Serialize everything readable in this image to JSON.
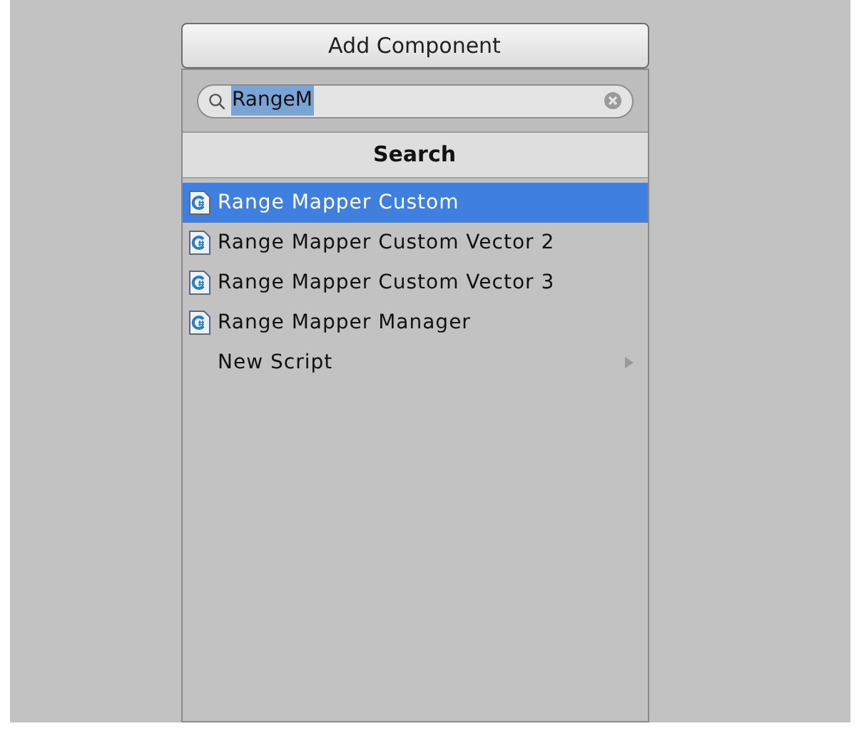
{
  "button": {
    "label": "Add Component"
  },
  "search": {
    "value": "RangeM",
    "text_selected": true
  },
  "header": {
    "title": "Search"
  },
  "items": [
    {
      "kind": "script",
      "label": "Range Mapper Custom",
      "selected": true
    },
    {
      "kind": "script",
      "label": "Range Mapper Custom Vector 2",
      "selected": false
    },
    {
      "kind": "script",
      "label": "Range Mapper Custom Vector 3",
      "selected": false
    },
    {
      "kind": "script",
      "label": "Range Mapper Manager",
      "selected": false
    },
    {
      "kind": "submenu",
      "label": "New Script",
      "selected": false
    }
  ]
}
